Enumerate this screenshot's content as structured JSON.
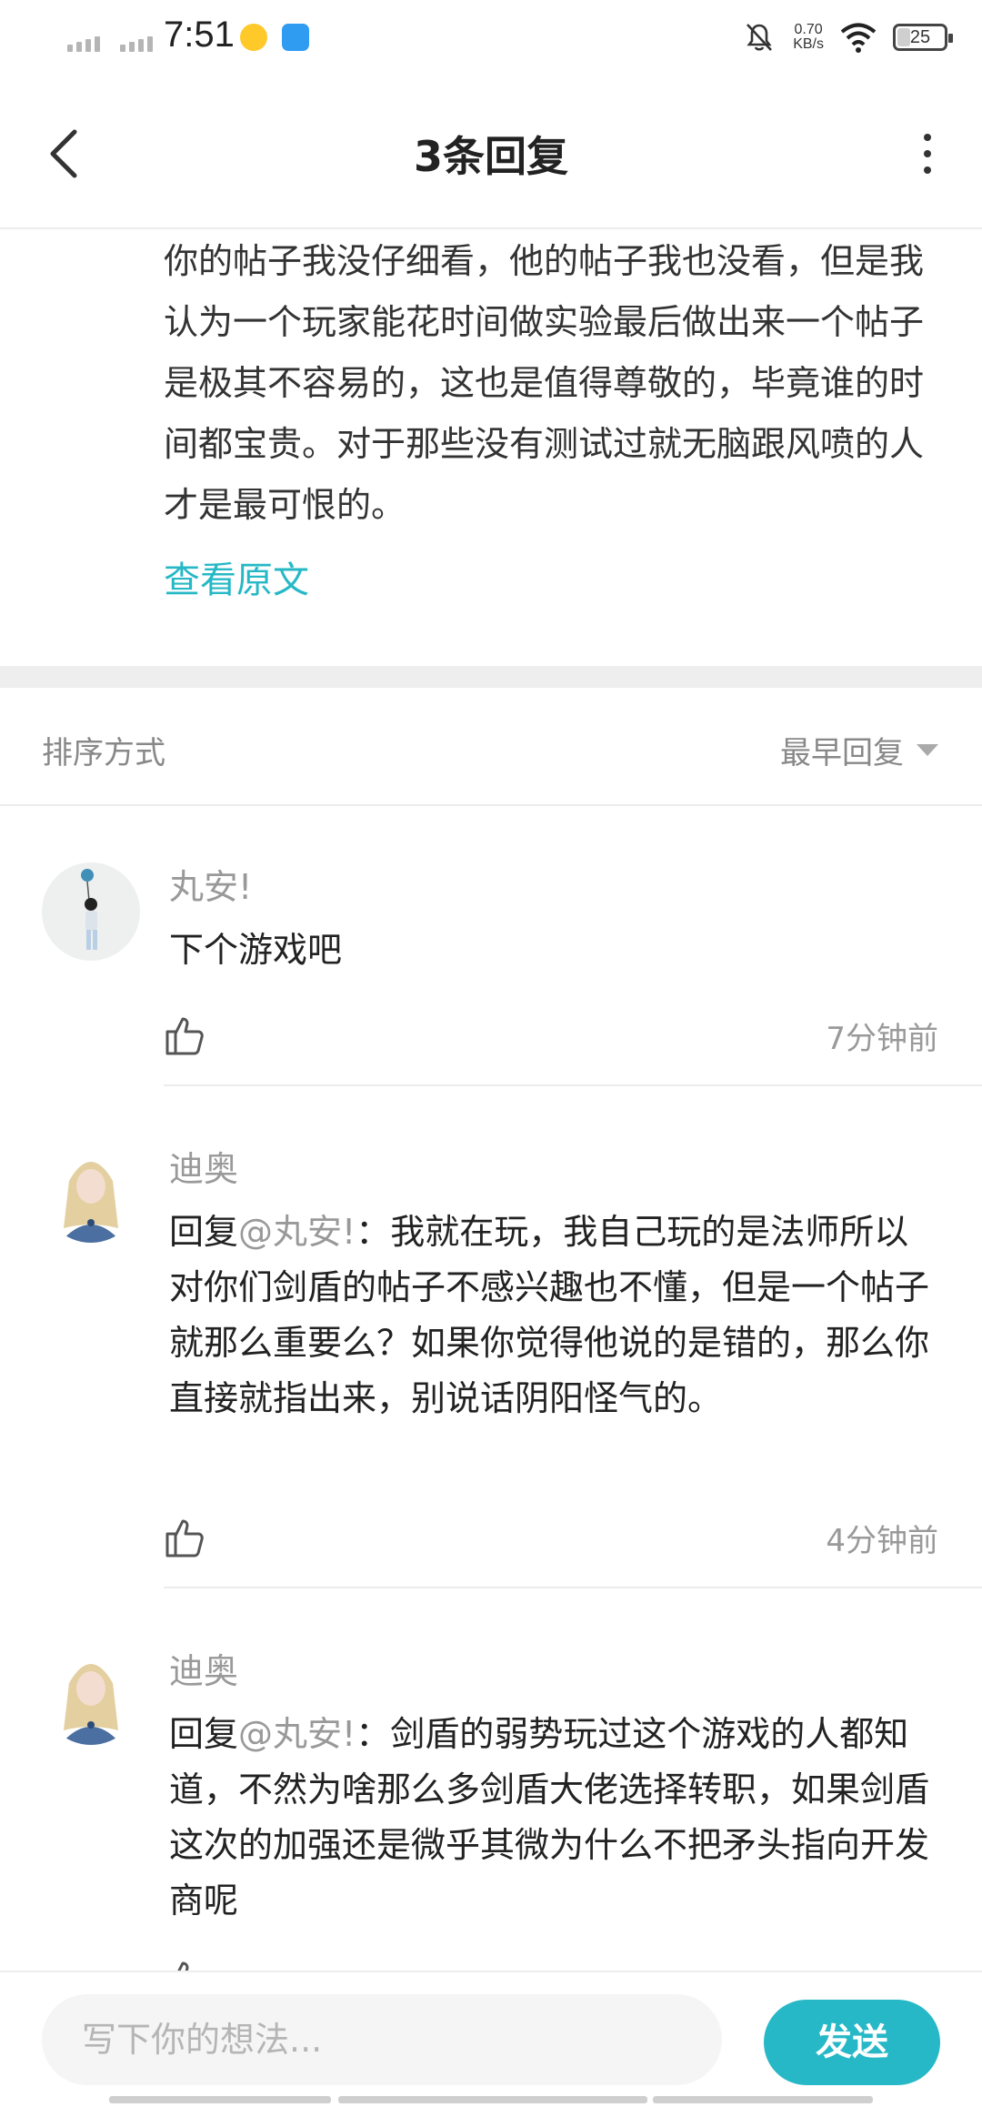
{
  "status_bar": {
    "time": "7:51",
    "net_speed_value": "0.70",
    "net_speed_unit": "KB/s",
    "battery": "25",
    "battery_level": 0.25
  },
  "header": {
    "title": "3条回复"
  },
  "original_post": {
    "text": "你的帖子我没仔细看，他的帖子我也没看，但是我认为一个玩家能花时间做实验最后做出来一个帖子是极其不容易的，这也是值得尊敬的，毕竟谁的时间都宝贵。对于那些没有测试过就无脑跟风喷的人才是最可恨的。",
    "view_original": "查看原文"
  },
  "sort": {
    "label": "排序方式",
    "selected": "最早回复"
  },
  "comments": [
    {
      "name": "丸安!",
      "reply_prefix": "",
      "reply_to": "",
      "reply_sep": "",
      "text": "下个游戏吧",
      "time": "7分钟前"
    },
    {
      "name": "迪奥",
      "reply_prefix": "回复",
      "reply_to": "@丸安!",
      "reply_sep": "：",
      "text": "我就在玩，我自己玩的是法师所以对你们剑盾的帖子不感兴趣也不懂，但是一个帖子就那么重要么？如果你觉得他说的是错的，那么你直接就指出来，别说话阴阳怪气的。",
      "time": "4分钟前"
    },
    {
      "name": "迪奥",
      "reply_prefix": "回复",
      "reply_to": "@丸安!",
      "reply_sep": "：",
      "text": "剑盾的弱势玩过这个游戏的人都知道，不然为啥那么多剑盾大佬选择转职，如果剑盾这次的加强还是微乎其微为什么不把矛头指向开发商呢",
      "time": ""
    }
  ],
  "input": {
    "placeholder": "写下你的想法..."
  },
  "send": {
    "label": "发送"
  },
  "colors": {
    "accent": "#26b8c6",
    "muted_text": "#999999",
    "divider": "#eeeeee"
  },
  "icons": [
    "back-arrow-icon",
    "more-vertical-icon",
    "thumbs-up-icon",
    "dropdown-caret-icon",
    "wifi-icon",
    "mute-bell-icon",
    "battery-icon",
    "signal-icon"
  ]
}
